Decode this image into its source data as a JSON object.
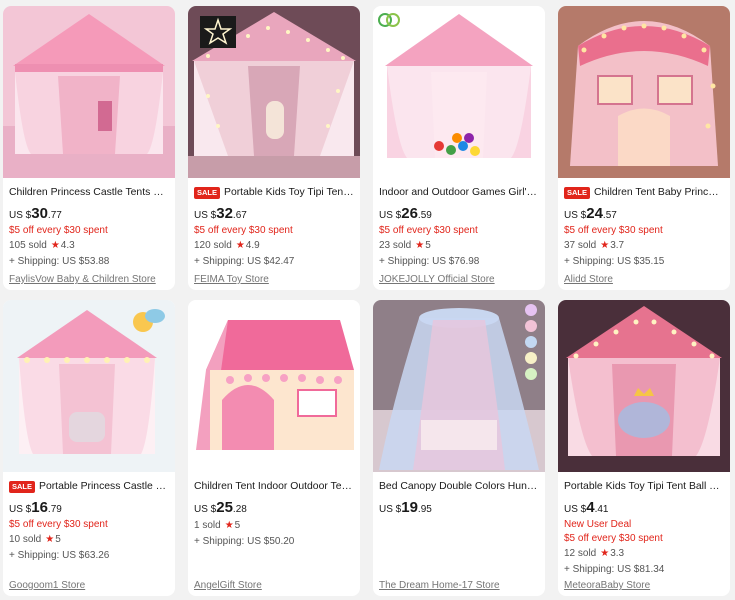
{
  "products": [
    {
      "title": "Children Princess Castle Tents Port...",
      "sale": false,
      "currency": "US $",
      "price_int": "30",
      "price_dec": ".77",
      "promo": "$5 off every $30 spent",
      "sold": "105 sold",
      "rating": "4.3",
      "shipping": "+ Shipping: US $53.88",
      "store": "FaylisVow Baby & Children Store"
    },
    {
      "title": "Portable Kids Toy Tipi Tent B...",
      "sale": true,
      "sale_label": "SALE",
      "currency": "US $",
      "price_int": "32",
      "price_dec": ".67",
      "promo": "$5 off every $30 spent",
      "sold": "120 sold",
      "rating": "4.9",
      "shipping": "+ Shipping: US $42.47",
      "store": "FEIMA Toy Store"
    },
    {
      "title": "Indoor and Outdoor Games Girl's ...",
      "sale": false,
      "currency": "US $",
      "price_int": "26",
      "price_dec": ".59",
      "promo": "$5 off every $30 spent",
      "sold": "23 sold",
      "rating": "5",
      "shipping": "+ Shipping: US $76.98",
      "store": "JOKEJOLLY Official Store"
    },
    {
      "title": "Children Tent Baby Princess ...",
      "sale": true,
      "sale_label": "SALE",
      "currency": "US $",
      "price_int": "24",
      "price_dec": ".57",
      "promo": "$5 off every $30 spent",
      "sold": "37 sold",
      "rating": "3.7",
      "shipping": "+ Shipping: US $35.15",
      "store": "Alidd Store"
    },
    {
      "title": "Portable Princess Castle Play...",
      "sale": true,
      "sale_label": "SALE",
      "currency": "US $",
      "price_int": "16",
      "price_dec": ".79",
      "promo": "$5 off every $30 spent",
      "sold": "10 sold",
      "rating": "5",
      "shipping": "+ Shipping: US $63.26",
      "store": "Googoom1 Store"
    },
    {
      "title": "Children Tent Indoor Outdoor Ten...",
      "sale": false,
      "currency": "US $",
      "price_int": "25",
      "price_dec": ".28",
      "promo": "",
      "sold": "1 sold",
      "rating": "5",
      "shipping": "+ Shipping: US $50.20",
      "store": "AngelGift Store"
    },
    {
      "title": "Bed Canopy Double Colors Hung ...",
      "sale": false,
      "currency": "US $",
      "price_int": "19",
      "price_dec": ".95",
      "promo": "",
      "sold": "",
      "rating": "",
      "shipping": "",
      "store": "The Dream Home-17 Store"
    },
    {
      "title": "Portable Kids Toy Tipi Tent Ball Pit ...",
      "sale": false,
      "currency": "US $",
      "price_int": "4",
      "price_dec": ".41",
      "new_user": "New User Deal",
      "promo": "$5 off every $30 spent",
      "sold": "12 sold",
      "rating": "3.3",
      "shipping": "+ Shipping: US $81.34",
      "store": "MeteoraBaby Store"
    }
  ],
  "icons": {
    "rating": "star-icon",
    "product_image": "pink-tent-photo"
  },
  "colors": {
    "accent": "#e1251b",
    "tent_pink": "#f7a8c4",
    "background": "#f2f2f2"
  }
}
